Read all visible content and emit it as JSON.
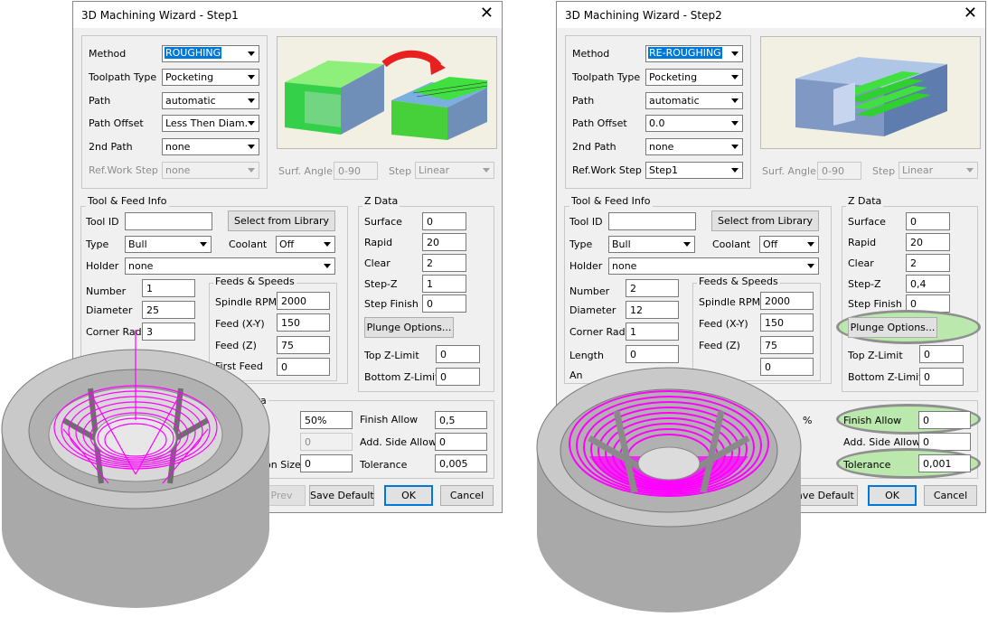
{
  "dialog1": {
    "title": "3D Machining Wizard - Step1",
    "method_label": "Method",
    "method_value": "ROUGHING",
    "toolpath_type_label": "Toolpath Type",
    "toolpath_type_value": "Pocketing",
    "path_label": "Path",
    "path_value": "automatic",
    "path_offset_label": "Path Offset",
    "path_offset_value": "Less Then Diam.",
    "second_path_label": "2nd Path",
    "second_path_value": "none",
    "ref_work_step_label": "Ref.Work Step",
    "ref_work_step_value": "none",
    "surf_angle_label": "Surf. Angle",
    "surf_angle_value": "0-90",
    "step_label": "Step",
    "step_value": "Linear",
    "tool_feed_group": "Tool & Feed Info",
    "tool_id_label": "Tool ID",
    "tool_id_value": "",
    "select_library": "Select from Library",
    "type_label": "Type",
    "type_value": "Bull",
    "coolant_label": "Coolant",
    "coolant_value": "Off",
    "holder_label": "Holder",
    "holder_value": "none",
    "number_label": "Number",
    "number_value": "1",
    "diameter_label": "Diameter",
    "diameter_value": "25",
    "corner_rad_label": "Corner Rad",
    "corner_rad_value": "3",
    "feeds_group": "Feeds & Speeds",
    "spindle_label": "Spindle RPM",
    "spindle_value": "2000",
    "feed_xy_label": "Feed (X-Y)",
    "feed_xy_value": "150",
    "feed_z_label": "Feed (Z)",
    "feed_z_value": "75",
    "first_feed_label": "First Feed",
    "first_feed_value": "0",
    "zdata_group": "Z Data",
    "surface_label": "Surface",
    "surface_value": "0",
    "rapid_label": "Rapid",
    "rapid_value": "20",
    "clear_label": "Clear",
    "clear_value": "2",
    "stepz_label": "Step-Z",
    "stepz_value": "1",
    "step_finish_label": "Step Finish",
    "step_finish_value": "0",
    "plunge_options": "Plunge Options...",
    "top_z_label": "Top Z-Limit",
    "top_z_value": "0",
    "bottom_z_label": "Bottom Z-Limit",
    "bottom_z_value": "0",
    "data_group_partial": "ata",
    "stepover_value": "50%",
    "disabled_value": "0",
    "region_size_partial": "gion Size",
    "region_size_value": "0",
    "finish_allow_label": "Finish Allow",
    "finish_allow_value": "0,5",
    "add_side_allow_label": "Add. Side Allow",
    "add_side_allow_value": "0",
    "tolerance_label": "Tolerance",
    "tolerance_value": "0,005",
    "prev": "Prev",
    "save_default": "Save Default",
    "ok": "OK",
    "cancel": "Cancel"
  },
  "dialog2": {
    "title": "3D Machining Wizard - Step2",
    "method_label": "Method",
    "method_value": "RE-ROUGHING",
    "toolpath_type_label": "Toolpath Type",
    "toolpath_type_value": "Pocketing",
    "path_label": "Path",
    "path_value": "automatic",
    "path_offset_label": "Path Offset",
    "path_offset_value": "0.0",
    "second_path_label": "2nd Path",
    "second_path_value": "none",
    "ref_work_step_label": "Ref.Work Step",
    "ref_work_step_value": "Step1",
    "surf_angle_label": "Surf. Angle",
    "surf_angle_value": "0-90",
    "step_label": "Step",
    "step_value": "Linear",
    "tool_feed_group": "Tool & Feed Info",
    "tool_id_label": "Tool ID",
    "tool_id_value": "",
    "select_library": "Select from Library",
    "type_label": "Type",
    "type_value": "Bull",
    "coolant_label": "Coolant",
    "coolant_value": "Off",
    "holder_label": "Holder",
    "holder_value": "none",
    "number_label": "Number",
    "number_value": "2",
    "diameter_label": "Diameter",
    "diameter_value": "12",
    "corner_rad_label": "Corner Rad",
    "corner_rad_value": "1",
    "length_label": "Length",
    "length_value": "0",
    "an_partial": "An",
    "feeds_group": "Feeds & Speeds",
    "spindle_label": "Spindle RPM",
    "spindle_value": "2000",
    "feed_xy_label": "Feed (X-Y)",
    "feed_xy_value": "150",
    "feed_z_label": "Feed (Z)",
    "feed_z_value": "75",
    "first_feed_value": "0",
    "zdata_group": "Z Data",
    "surface_label": "Surface",
    "surface_value": "0",
    "rapid_label": "Rapid",
    "rapid_value": "20",
    "clear_label": "Clear",
    "clear_value": "2",
    "stepz_label": "Step-Z",
    "stepz_value": "0,4",
    "step_finish_label": "Step Finish",
    "step_finish_value": "0",
    "plunge_options": "Plunge Options...",
    "top_z_label": "Top Z-Limit",
    "top_z_value": "0",
    "bottom_z_label": "Bottom Z-Limit",
    "bottom_z_value": "0",
    "stepover_partial": "%",
    "finish_allow_label": "Finish Allow",
    "finish_allow_value": "0",
    "add_side_allow_label": "Add. Side Allow",
    "add_side_allow_value": "0",
    "tolerance_label": "Tolerance",
    "tolerance_value": "0,001",
    "save_default_partial": "ave Default",
    "ok": "OK",
    "cancel": "Cancel"
  },
  "colors": {
    "selection": "#0078d7",
    "toolpath": "#ff00ff",
    "highlight": "#a8e496",
    "part_gray": "#bdbdbd"
  }
}
